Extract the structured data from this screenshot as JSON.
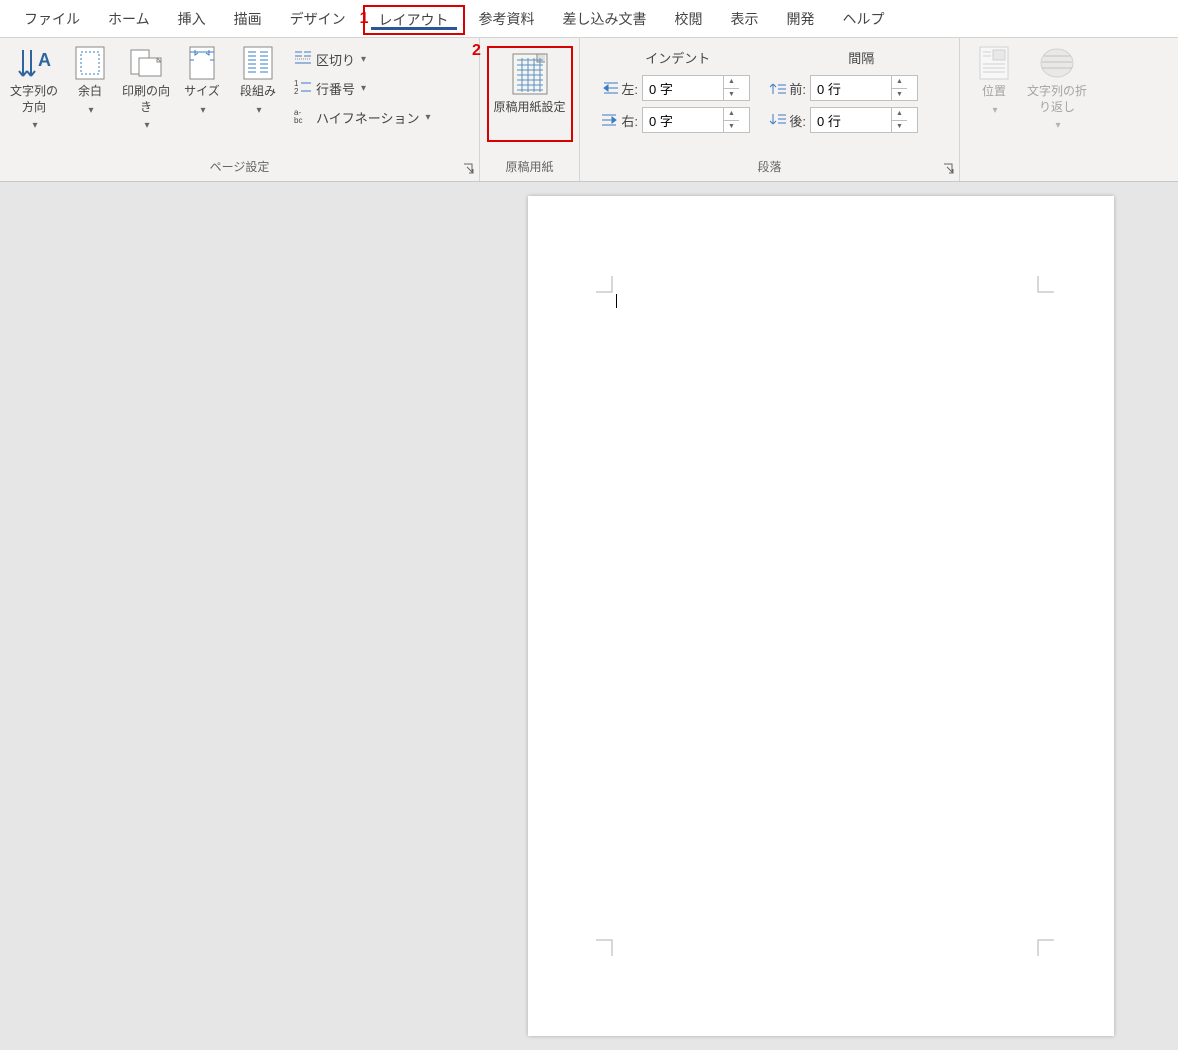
{
  "annotations": {
    "one": "1",
    "two": "2"
  },
  "tabs": {
    "file": "ファイル",
    "home": "ホーム",
    "insert": "挿入",
    "draw": "描画",
    "design": "デザイン",
    "layout": "レイアウト",
    "references": "参考資料",
    "mailings": "差し込み文書",
    "review": "校閲",
    "view": "表示",
    "developer": "開発",
    "help": "ヘルプ"
  },
  "page_setup": {
    "text_direction": "文字列の方向",
    "margins": "余白",
    "orientation": "印刷の向き",
    "size": "サイズ",
    "columns": "段組み",
    "breaks": "区切り",
    "line_numbers": "行番号",
    "hyphenation": "ハイフネーション",
    "group_label": "ページ設定"
  },
  "genkou": {
    "button": "原稿用紙設定",
    "group_label": "原稿用紙"
  },
  "paragraph": {
    "indent_header": "インデント",
    "spacing_header": "間隔",
    "left_label": "左:",
    "right_label": "右:",
    "before_label": "前:",
    "after_label": "後:",
    "left_value": "0 字",
    "right_value": "0 字",
    "before_value": "0 行",
    "after_value": "0 行",
    "group_label": "段落"
  },
  "arrange": {
    "position": "位置",
    "wrap": "文字列の折り返し"
  }
}
